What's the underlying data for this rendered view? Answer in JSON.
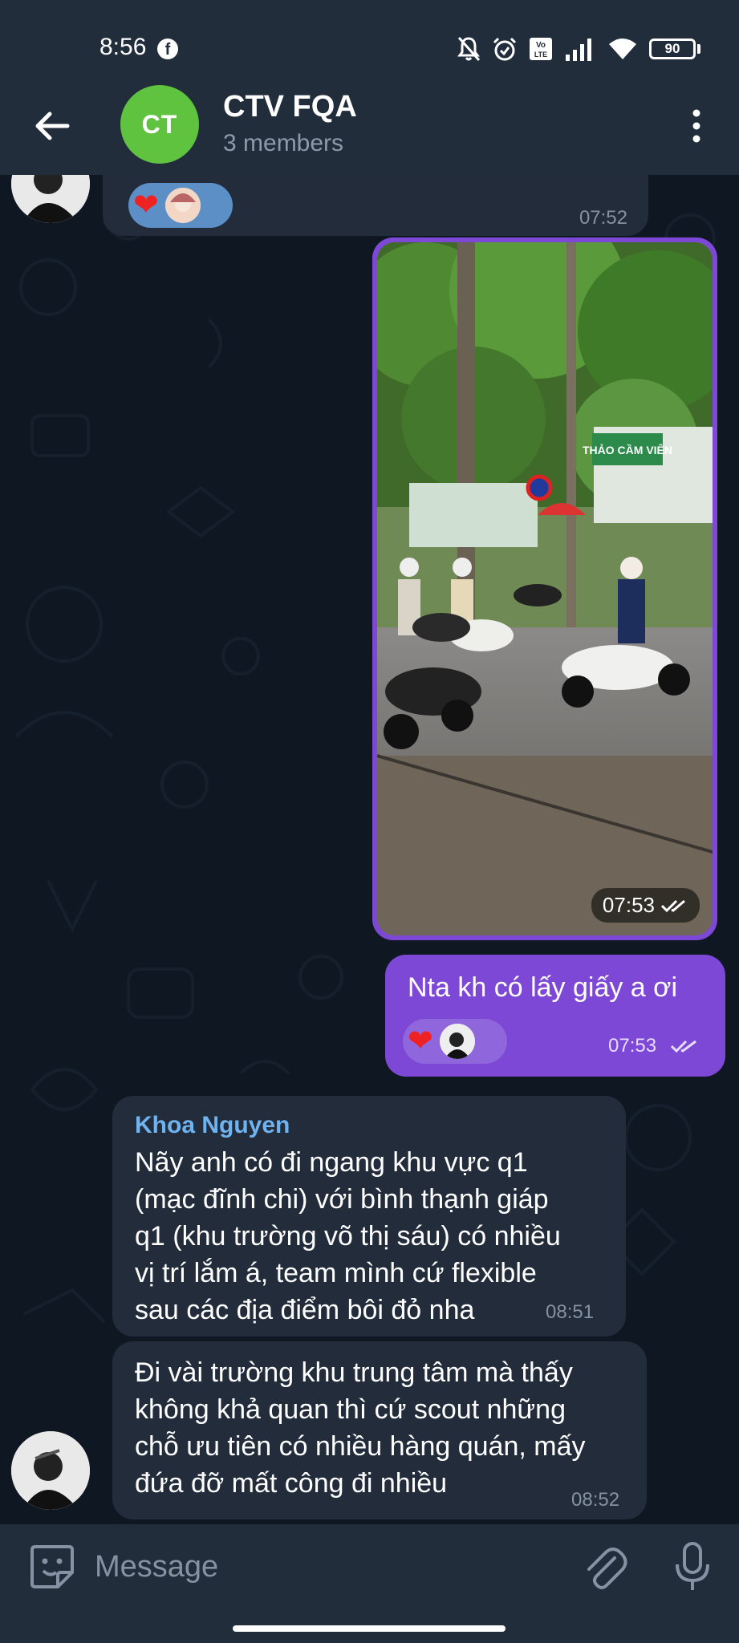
{
  "status_bar": {
    "time": "8:56",
    "app_icon": "facebook-icon",
    "icons": [
      "mute-icon",
      "alarm-icon",
      "volte-icon",
      "signal-icon",
      "wifi-icon"
    ],
    "battery": "90"
  },
  "header": {
    "avatar_initials": "CT",
    "avatar_color": "#5fc33f",
    "title": "CTV FQA",
    "subtitle": "3 members"
  },
  "messages": [
    {
      "direction": "in",
      "time": "07:52",
      "reaction": "❤"
    },
    {
      "direction": "out",
      "type": "photo",
      "time": "07:53"
    },
    {
      "direction": "out",
      "text": "Nta kh có lấy giấy a ơi",
      "reaction": "❤",
      "time": "07:53"
    },
    {
      "direction": "in",
      "sender": "Khoa Nguyen",
      "text_lines": [
        "Nãy anh có đi ngang khu vực q1",
        "(mạc đĩnh chi) với bình thạnh giáp",
        "q1 (khu trường võ thị sáu) có nhiều",
        "vị trí lắm á, team mình cứ flexible",
        "sau các địa điểm bôi đỏ nha"
      ],
      "time": "08:51"
    },
    {
      "direction": "in",
      "text_lines": [
        "Đi vài trường khu trung tâm mà thấy",
        "không khả quan thì cứ scout những",
        "chỗ ưu tiên có nhiều hàng quán, mấy",
        "đứa đỡ mất công đi nhiều"
      ],
      "time": "08:52"
    }
  ],
  "composer": {
    "placeholder": "Message"
  },
  "colors": {
    "accent_outgoing": "#7d48d6",
    "incoming_bubble": "#222c3a",
    "sender_name": "#6fb3f0",
    "header_bg": "#212d3b"
  }
}
